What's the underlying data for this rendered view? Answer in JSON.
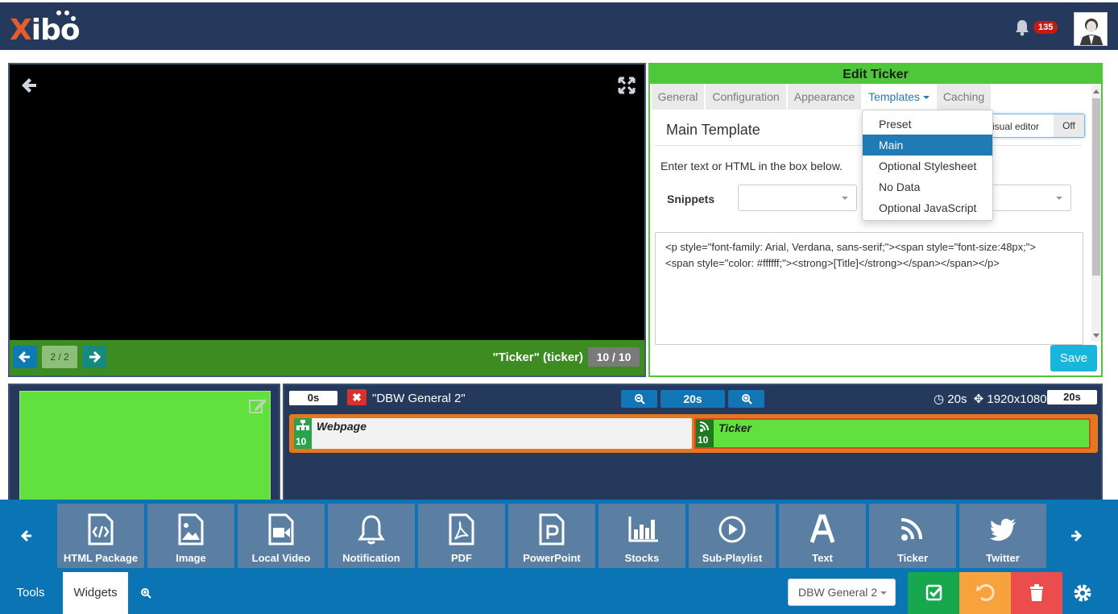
{
  "header": {
    "logo_x": "X",
    "logo_rest": "ibo",
    "notification_count": "135"
  },
  "preview": {
    "page_indicator": "2 / 2",
    "widget_label": "\"Ticker\" (ticker)",
    "widget_count": "10 / 10"
  },
  "edit_panel": {
    "title": "Edit Ticker",
    "tabs": [
      "General",
      "Configuration",
      "Appearance",
      "Templates",
      "Caching"
    ],
    "section_title": "Main Template",
    "visual_editor_label": "isual editor",
    "visual_editor_state": "Off",
    "hint": "Enter text or HTML in the box below.",
    "snippets_label": "Snippets",
    "code_line1": "<p style=\"font-family: Arial, Verdana, sans-serif;\"><span style=\"font-size:48px;\">",
    "code_line2": "<span style=\"color: #ffffff;\"><strong>[Title]</strong></span></span></p>",
    "save_label": "Save"
  },
  "templates_menu": {
    "items": [
      "Preset",
      "Main",
      "Optional Stylesheet",
      "No Data",
      "Optional JavaScript"
    ],
    "selected": "Main"
  },
  "timeline": {
    "start_time": "0s",
    "delete_symbol": "✖",
    "playlist_name": "\"DBW General 2\"",
    "zoom_value": "20s",
    "duration": "20s",
    "resolution": "1920x1080",
    "end_time": "20s",
    "widgets": [
      {
        "name": "Webpage",
        "count": "10"
      },
      {
        "name": "Ticker",
        "count": "10"
      }
    ]
  },
  "widget_toolbar": {
    "items": [
      "HTML Package",
      "Image",
      "Local Video",
      "Notification",
      "PDF",
      "PowerPoint",
      "Stocks",
      "Sub-Playlist",
      "Text",
      "Ticker",
      "Twitter"
    ]
  },
  "bottom_bar": {
    "tabs": [
      "Tools",
      "Widgets"
    ],
    "layout_select": "DBW General 2"
  },
  "colors": {
    "header": "#24395c",
    "accent_green": "#4ec83a",
    "widget_green": "#62e03e",
    "toolbar_blue": "#0a74b4",
    "orange": "#e67721",
    "save": "#18b6dd"
  }
}
